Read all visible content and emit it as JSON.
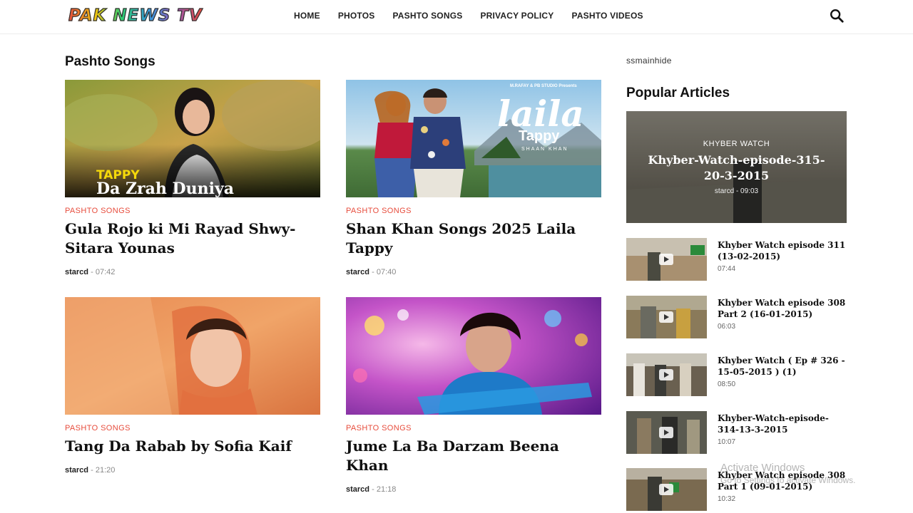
{
  "site": {
    "logo": "PAK NEWS TV"
  },
  "nav": [
    "HOME",
    "PHOTOS",
    "PASHTO SONGS",
    "PRIVACY POLICY",
    "PASHTO VIDEOS"
  ],
  "colors": {
    "accent": "#e74c3c"
  },
  "main": {
    "title": "Pashto Songs",
    "posts": [
      {
        "category": "PASHTO SONGS",
        "title": "Gula Rojo ki Mi Rayad Shwy-Sitara Younas",
        "author": "starcd",
        "time": "07:42",
        "thumb_caption_small": "TAPPY",
        "thumb_caption_big": "Da Zrah Duniya"
      },
      {
        "category": "PASHTO SONGS",
        "title": "Shan Khan Songs 2025 Laila Tappy",
        "author": "starcd",
        "time": "07:40",
        "thumb_caption_small": "M.RAFAY & PB STUDIO Presents",
        "thumb_caption_big": "laila",
        "thumb_caption_sub": "Tappy",
        "thumb_caption_name": "SHAAN KHAN"
      },
      {
        "category": "PASHTO SONGS",
        "title": "Tang Da Rabab by Sofia Kaif",
        "author": "starcd",
        "time": "21:20"
      },
      {
        "category": "PASHTO SONGS",
        "title": "Jume La Ba Darzam Beena Khan",
        "author": "starcd",
        "time": "21:18"
      }
    ]
  },
  "sidebar": {
    "note": "ssmainhide",
    "title": "Popular Articles",
    "featured": {
      "category": "KHYBER WATCH",
      "title": "Khyber-Watch-episode-315-20-3-2015",
      "author": "starcd",
      "time": "09:03"
    },
    "items": [
      {
        "title": "Khyber Watch episode 311 (13-02-2015)",
        "time": "07:44"
      },
      {
        "title": "Khyber Watch episode 308 Part 2 (16-01-2015)",
        "time": "06:03"
      },
      {
        "title": "Khyber Watch ( Ep # 326 - 15-05-2015 ) (1)",
        "time": "08:50"
      },
      {
        "title": "Khyber-Watch-episode-314-13-3-2015",
        "time": "10:07"
      },
      {
        "title": "Khyber Watch episode 308 Part 1 (09-01-2015)",
        "time": "10:32"
      }
    ]
  },
  "os_watermark": {
    "line1": "Activate Windows",
    "line2": "Go to Settings to activate Windows."
  }
}
